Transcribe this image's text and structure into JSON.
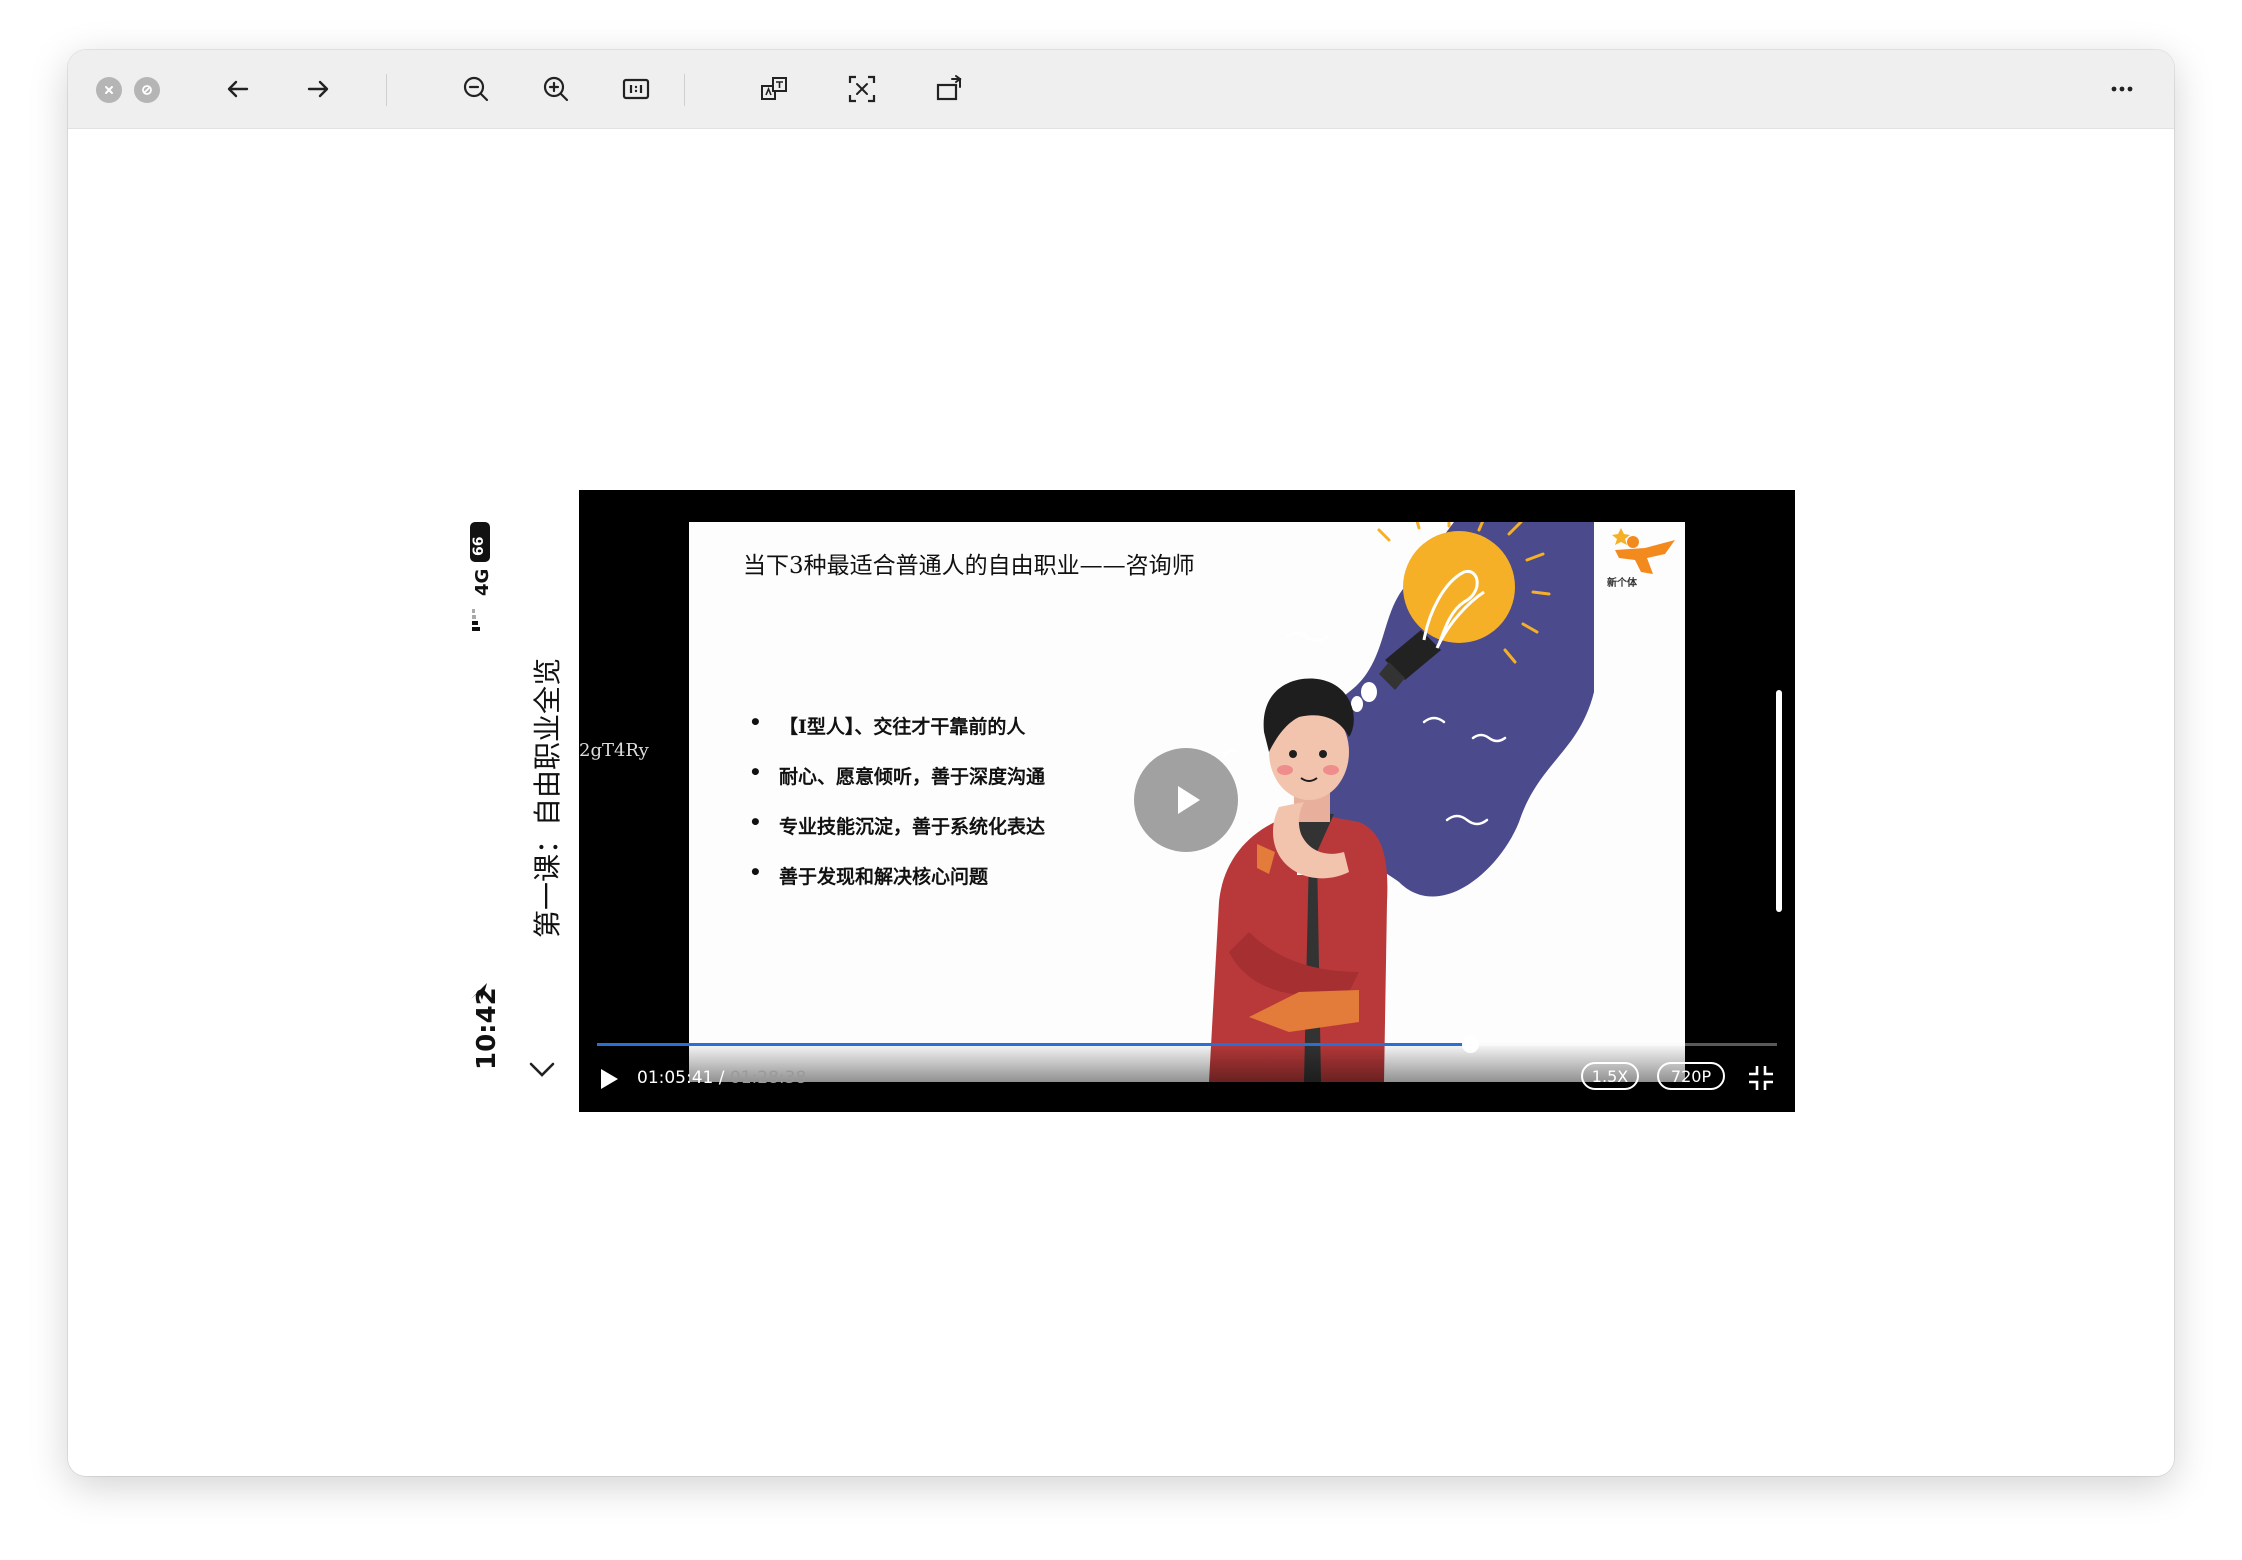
{
  "toolbar": {
    "buttons": [
      "close-circle",
      "block-circle",
      "back",
      "forward",
      "zoom-out",
      "zoom-in",
      "actual-size",
      "translate",
      "text-recognize",
      "rotate"
    ],
    "more": "more"
  },
  "status": {
    "time": "10:42",
    "network": "4G",
    "battery": "66"
  },
  "course_title": "第一课：自由职业全览",
  "video": {
    "watermark": "2gT4Ry",
    "slide_title": "当下3种最适合普通人的自由职业——咨询师",
    "bullets": [
      "【I型人】、交往才干靠前的人",
      "耐心、愿意倾听，善于深度沟通",
      "专业技能沉淀，善于系统化表达",
      "善于发现和解决核心问题"
    ],
    "logo_text": "新个体",
    "current_time": "01:05:41",
    "separator": " / ",
    "total_time": "01:28:38",
    "progress": 0.74,
    "speed": "1.5X",
    "quality": "720P"
  },
  "colors": {
    "progress": "#2b6fd6",
    "blob": "#4a4a8c",
    "bulb": "#f6b027",
    "shirt": "#b9393a"
  }
}
